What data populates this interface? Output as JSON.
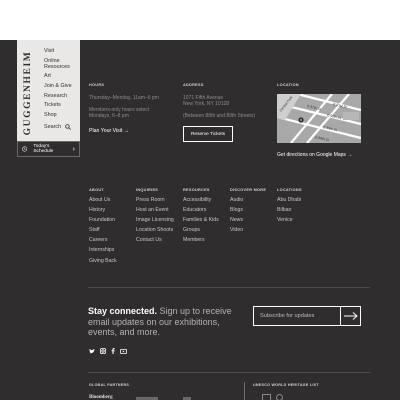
{
  "sidenav": {
    "logo": "GUGGENHEIM",
    "items": [
      "Visit",
      "Online Resources",
      "Art",
      "Join & Give",
      "Research",
      "Tickets",
      "Shop"
    ],
    "search_label": "Search",
    "schedule_label": "Today's Schedule"
  },
  "hours": {
    "label": "Hours",
    "line1": "Thursday–Monday, 11am–6 pm",
    "line2": "Members-only hours select Mondays, 6–8 pm",
    "link": "Plan Your Visit →"
  },
  "address": {
    "label": "Address",
    "line1": "1071 Fifth Avenue",
    "line2": "New York, NY 10128",
    "line3": "(Between 88th and 89th Streets)",
    "button": "Reserve Tickets"
  },
  "location": {
    "label": "Location",
    "streets": [
      "E 91st St",
      "E 90th St",
      "E 89th St",
      "E 88th St",
      "E 87th St",
      "Central Park"
    ],
    "link": "Get directions on Google Maps →"
  },
  "columns": [
    {
      "head": "About",
      "items": [
        "About Us",
        "History",
        "Foundation",
        "Staff",
        "Careers",
        "Internships",
        "Giving Back"
      ]
    },
    {
      "head": "Inquiries",
      "items": [
        "Press Room",
        "Host an Event",
        "Image Licensing",
        "Location Shoots",
        "Contact Us"
      ]
    },
    {
      "head": "Resources",
      "items": [
        "Accessibility",
        "Educators",
        "Families & Kids",
        "Groups",
        "Members"
      ]
    },
    {
      "head": "Discover More",
      "items": [
        "Audio",
        "Blogs",
        "News",
        "Video"
      ]
    },
    {
      "head": "Locations",
      "items": [
        "Abu Dhabi",
        "Bilbao",
        "Venice"
      ]
    }
  ],
  "newsletter": {
    "bold": "Stay connected.",
    "rest": " Sign up to receive email updates on our exhibitions, events, and more.",
    "placeholder": "Subscribe for updates"
  },
  "social_icons": [
    "twitter-icon",
    "instagram-icon",
    "facebook-icon",
    "youtube-icon"
  ],
  "bottom": {
    "partners_label": "Global Partners",
    "partner_logo": "Bloomberg",
    "unesco_label": "UNESCO World Heritage List"
  }
}
